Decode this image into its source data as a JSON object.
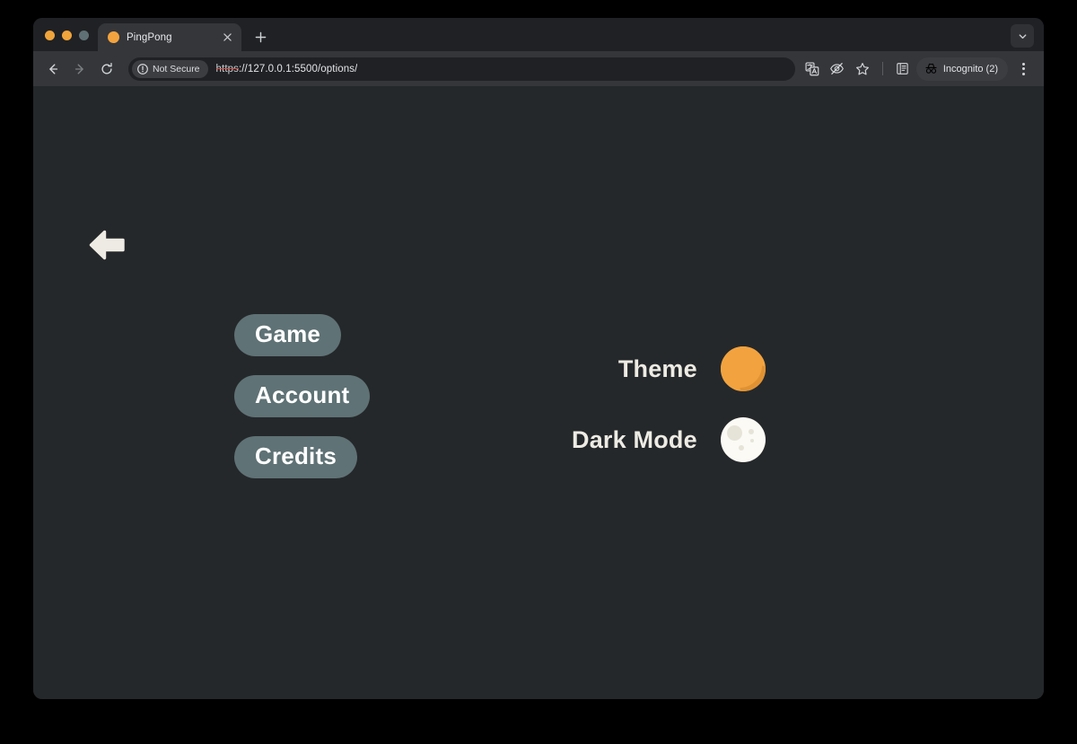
{
  "browser": {
    "traffic_lights": [
      {
        "name": "close",
        "color": "#F0A43C"
      },
      {
        "name": "minimize",
        "color": "#F0A43C"
      },
      {
        "name": "maximize",
        "color": "#5F7175"
      }
    ],
    "tab": {
      "title": "PingPong",
      "favicon_color": "#F2A33F",
      "close_icon": "close-icon"
    },
    "new_tab_icon": "plus-icon",
    "tab_list_chevron_icon": "chevron-down-icon",
    "nav": {
      "back_icon": "back-arrow-icon",
      "forward_icon": "forward-arrow-icon",
      "reload_icon": "reload-icon"
    },
    "omnibox": {
      "security_icon": "not-secure-icon",
      "security_label": "Not Secure",
      "url_scheme": "https",
      "url_rest": "://127.0.0.1:5500/options/",
      "url_full": "https://127.0.0.1:5500/options/"
    },
    "toolbar_right": {
      "translate_icon": "translate-icon",
      "tracking_protection_icon": "eye-slash-icon",
      "bookmark_icon": "star-icon",
      "reading_list_icon": "reading-list-icon",
      "incognito_icon": "incognito-icon",
      "incognito_label": "Incognito (2)",
      "menu_icon": "three-dot-menu-icon"
    }
  },
  "page": {
    "background_color": "#25282B",
    "back_button_icon": "back-arrow-icon",
    "menu_buttons": [
      {
        "label": "Game"
      },
      {
        "label": "Account"
      },
      {
        "label": "Credits"
      }
    ],
    "settings": [
      {
        "label": "Theme",
        "control": "color-swatch",
        "value_color": "#F2A33F"
      },
      {
        "label": "Dark Mode",
        "control": "moon-toggle",
        "value_color": "#FBFAF4"
      }
    ],
    "button_color": "#5F7275",
    "text_color": "#EDEBE3"
  }
}
